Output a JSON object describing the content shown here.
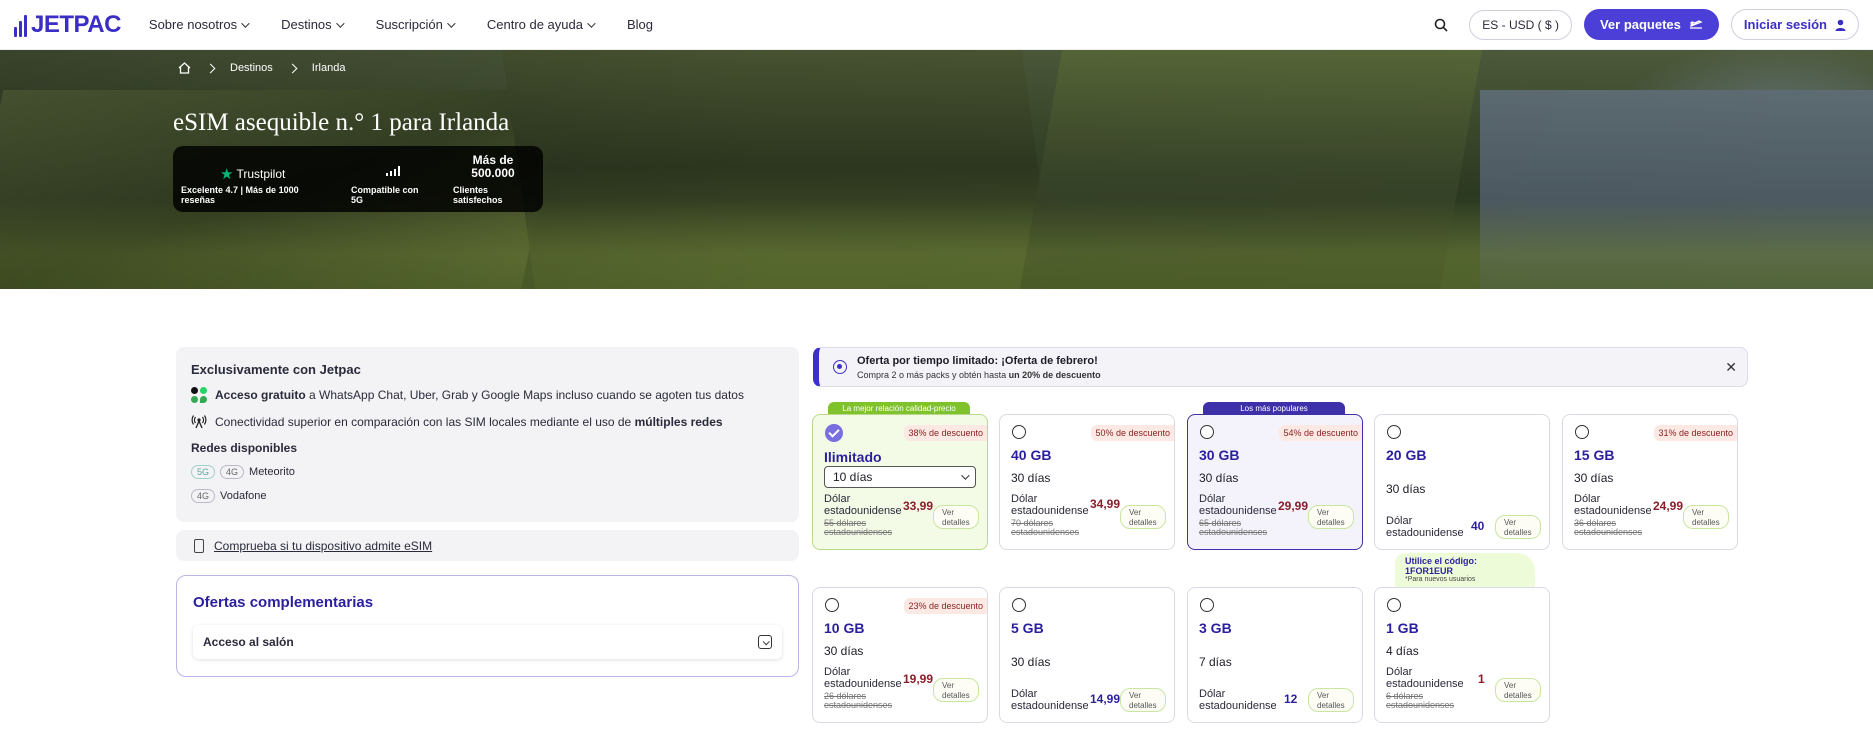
{
  "header": {
    "logo": "JETPAC",
    "nav": [
      {
        "label": "Sobre nosotros"
      },
      {
        "label": "Destinos"
      },
      {
        "label": "Suscripción"
      },
      {
        "label": "Centro de ayuda"
      },
      {
        "label": "Blog"
      }
    ],
    "locale": "ES - USD ( $ )",
    "cta": "Ver paquetes",
    "login": "Iniciar sesión"
  },
  "breadcrumb": {
    "destinos": "Destinos",
    "country": "Irlanda"
  },
  "hero": {
    "title": "eSIM asequible n.° 1 para Irlanda",
    "trustpilot": "Trustpilot",
    "rating": "Excelente 4.7 | Más de 1000 reseñas",
    "compat": "Compatible con 5G",
    "count": "Más de 500.000",
    "clients": "Clientes satisfechos"
  },
  "info": {
    "title": "Exclusivamente con Jetpac",
    "row1_bold": "Acceso gratuito",
    "row1_rest": "a WhatsApp Chat, Uber, Grab y Google Maps incluso cuando se agoten tus datos",
    "row2_pre": "Conectividad superior en comparación con las SIM locales mediante el uso de",
    "row2_bold": "múltiples redes",
    "networks_title": "Redes disponibles",
    "networks": [
      {
        "tags": [
          "5G",
          "4G"
        ],
        "name": "Meteorito"
      },
      {
        "tags": [
          "4G"
        ],
        "name": "Vodafone"
      }
    ]
  },
  "device": {
    "link": "Comprueba si tu dispositivo admite eSIM"
  },
  "offers": {
    "title": "Ofertas complementarias",
    "lounge": "Acceso al salón"
  },
  "promo": {
    "title": "Oferta por tiempo limitado: ¡Oferta de febrero!",
    "sub_pre": "Compra 2 o más packs y obtén hasta",
    "sub_bold": "un 20% de descuento"
  },
  "badges": {
    "best": "La mejor relación calidad-precio",
    "popular": "Los más populares"
  },
  "code_tip": {
    "l1": "Utilice el código:",
    "l2": "1FOR1EUR",
    "l3": "*Para nuevos usuarios"
  },
  "common": {
    "currency": "Dólar estadounidense",
    "details": "Ver detalles",
    "old_suffix": "dólares estadounidenses"
  },
  "plans": [
    {
      "gb": "Ilimitado",
      "days": "10 días",
      "price": "33,99",
      "old": "55 dólares estadounidenses",
      "discount": "38% de descuento"
    },
    {
      "gb": "40 GB",
      "days": "30 días",
      "price": "34,99",
      "old": "70 dólares estadounidenses",
      "discount": "50% de descuento"
    },
    {
      "gb": "30 GB",
      "days": "30 días",
      "price": "29,99",
      "old": "65 dólares estadounidenses",
      "discount": "54% de descuento"
    },
    {
      "gb": "20 GB",
      "days": "30 días",
      "price": "40",
      "old": "",
      "discount": ""
    },
    {
      "gb": "15 GB",
      "days": "30 días",
      "price": "24,99",
      "old": "36 dólares estadounidenses",
      "discount": "31% de descuento"
    },
    {
      "gb": "10 GB",
      "days": "30 días",
      "price": "19,99",
      "old": "26 dólares estadounidenses",
      "discount": "23% de descuento"
    },
    {
      "gb": "5 GB",
      "days": "30 días",
      "price": "14,99",
      "old": "",
      "discount": ""
    },
    {
      "gb": "3 GB",
      "days": "7 días",
      "price": "12",
      "old": "",
      "discount": ""
    },
    {
      "gb": "1 GB",
      "days": "4 días",
      "price": "1",
      "old": "6 dólares estadounidenses",
      "discount": ""
    }
  ],
  "colors": {
    "brand": "#3b2ec4",
    "cta": "#4c3fd8",
    "discount_bg": "#fde9e4",
    "selected_bg": "#f3fbe6"
  }
}
